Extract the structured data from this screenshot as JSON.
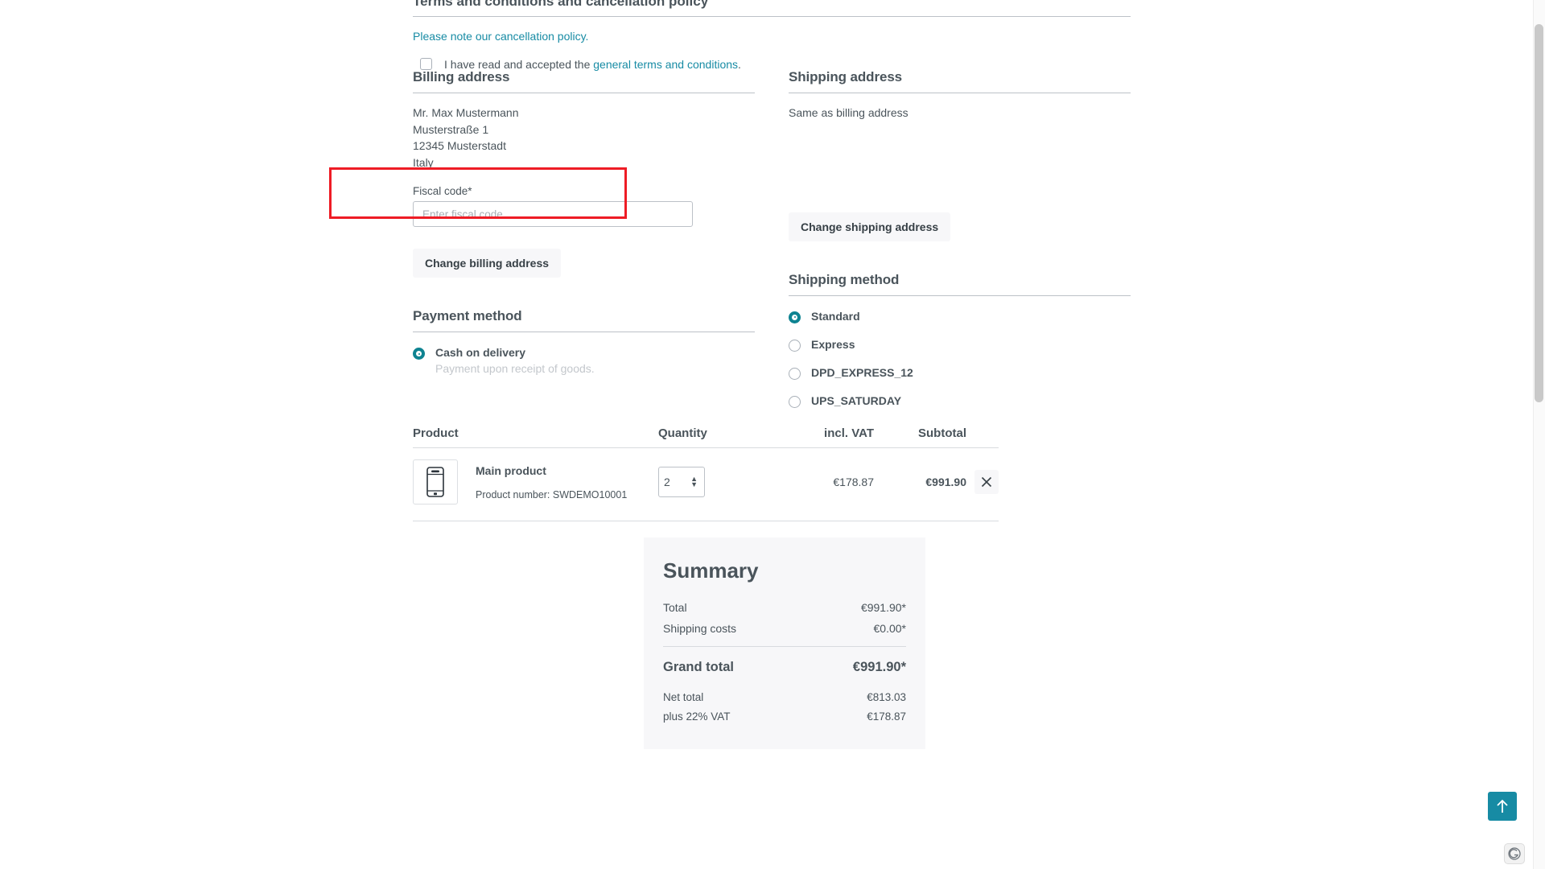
{
  "terms": {
    "title": "Terms and conditions and cancellation policy",
    "cancellation_link": "Please note our cancellation policy.",
    "checkbox_prefix": "I have read and accepted the ",
    "checkbox_link": "general terms and conditions",
    "checkbox_suffix": ".",
    "checkbox_checked": false
  },
  "billing": {
    "title": "Billing address",
    "lines": [
      "Mr. Max Mustermann",
      "Musterstraße 1",
      "12345 Musterstadt",
      "Italy"
    ],
    "fiscal_label": "Fiscal code*",
    "fiscal_value": "",
    "fiscal_placeholder": "Enter fiscal code...",
    "change_button": "Change billing address"
  },
  "shipping": {
    "title": "Shipping address",
    "text": "Same as billing address",
    "change_button": "Change shipping address"
  },
  "payment_method": {
    "title": "Payment method",
    "options": [
      {
        "label": "Cash on delivery",
        "description": "Payment upon receipt of goods.",
        "selected": true
      }
    ]
  },
  "shipping_method": {
    "title": "Shipping method",
    "options": [
      {
        "label": "Standard",
        "selected": true
      },
      {
        "label": "Express",
        "selected": false
      },
      {
        "label": "DPD_EXPRESS_12",
        "selected": false
      },
      {
        "label": "UPS_SATURDAY",
        "selected": false
      }
    ]
  },
  "cart": {
    "headers": {
      "product": "Product",
      "quantity": "Quantity",
      "vat": "incl. VAT",
      "subtotal": "Subtotal"
    },
    "items": [
      {
        "name": "Main product",
        "product_number_label": "Product number: SWDEMO10001",
        "quantity": "2",
        "vat": "€178.87",
        "subtotal": "€991.90",
        "thumbnail_icon": "smartphone-icon",
        "remove_icon": "close-icon"
      }
    ]
  },
  "summary": {
    "title": "Summary",
    "rows": [
      {
        "label": "Total",
        "value": "€991.90*"
      },
      {
        "label": "Shipping costs",
        "value": "€0.00*"
      }
    ],
    "grand": {
      "label": "Grand total",
      "value": "€991.90*"
    },
    "extra_rows": [
      {
        "label": "Net total",
        "value": "€813.03"
      },
      {
        "label": "plus 22% VAT",
        "value": "€178.87"
      }
    ]
  },
  "floating": {
    "scroll_top_icon": "arrow-up-icon",
    "badge_icon": "shopware-badge-icon"
  },
  "colors": {
    "accent": "#178ba4",
    "radio_selected": "#0e8391",
    "highlight_border": "#ee1c25",
    "text": "#4a545b",
    "panel_bg": "#f7f7f9"
  }
}
